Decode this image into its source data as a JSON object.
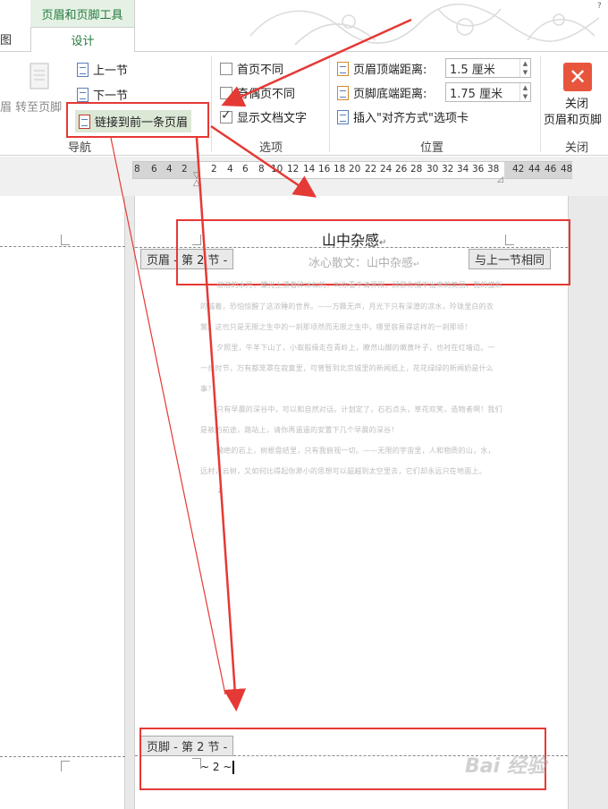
{
  "ribbon": {
    "context_tab_group": "页眉和页脚工具",
    "tab_left_partial": "图",
    "tab_design": "设计",
    "nav": {
      "goto_footer_partial": "眉 转至页脚",
      "prev_section": "上一节",
      "next_section": "下一节",
      "link_to_previous": "链接到前一条页眉",
      "group_label": "导航"
    },
    "options": {
      "different_first_page": "首页不同",
      "different_odd_even": "奇偶页不同",
      "show_document_text": "显示文档文字",
      "group_label": "选项"
    },
    "position": {
      "header_from_top_label": "页眉顶端距离:",
      "header_from_top_value": "1.5 厘米",
      "footer_from_bottom_label": "页脚底端距离:",
      "footer_from_bottom_value": "1.75 厘米",
      "insert_align_tab": "插入\"对齐方式\"选项卡",
      "group_label": "位置"
    },
    "close": {
      "label_line1": "关闭",
      "label_line2": "页眉和页脚",
      "group_label": "关闭"
    }
  },
  "ruler": {
    "left_numbers": [
      "8",
      "6",
      "4",
      "2"
    ],
    "right_numbers": [
      "2",
      "4",
      "6",
      "8",
      "10",
      "12",
      "14",
      "16",
      "18",
      "20",
      "22",
      "24",
      "26",
      "28",
      "30",
      "32",
      "34",
      "36",
      "38"
    ],
    "margin_numbers": [
      "42",
      "44",
      "46",
      "48"
    ]
  },
  "document": {
    "header_text": "山中杂感",
    "header_tag": "页眉 - 第 2 节 -",
    "same_as_previous": "与上一节相同",
    "subtitle": "冰心散文：山中杂感",
    "footer_tag": "页脚 - 第 2 节 -",
    "page_number": "~ 2 ~",
    "body_lines": [
      "溶溶的水月，螺光上漂着碎冰似的，叫你看不清界限，顾景你描不出来的美丽，我的拔彩",
      "的诚着，恐怕惊醒了这浓睡的世界。——万籁无声，月光下只有深潜的凉水，玲珑里白的衣",
      "裳。这也只是无限之生中的一刹那顷然而无限之生中，哪里容易得这样的一刹那顷！",
      "夕照里，牛羊下山了，小蚁般缘走在青岭上，瞭然山脚的嫩黄叶子，也衬在红墙边。一",
      "一丝时节，万有都笼罩在寂寞里，可曾暂到北京城里的新闻纸上，花花绿绿的新闻奶是什么",
      "事？",
      "只有早晨的深谷中，可以和自然对话。计划定了，石石点头，草花欢笑，造物者啊！我们",
      "是被的前途，路站上，请你再遥遥的安置下几个早晨的深谷！",
      "婉绝的岩上，树根盘结里，只有我俯视一切。——无限的宇宙里，人和物质的山，水，",
      "远村，云树，又如何比得起你渺小的思想可以超越到太空里去，它们却永远只在地面上。",
      "↓"
    ]
  },
  "watermark": "Bai 经验"
}
